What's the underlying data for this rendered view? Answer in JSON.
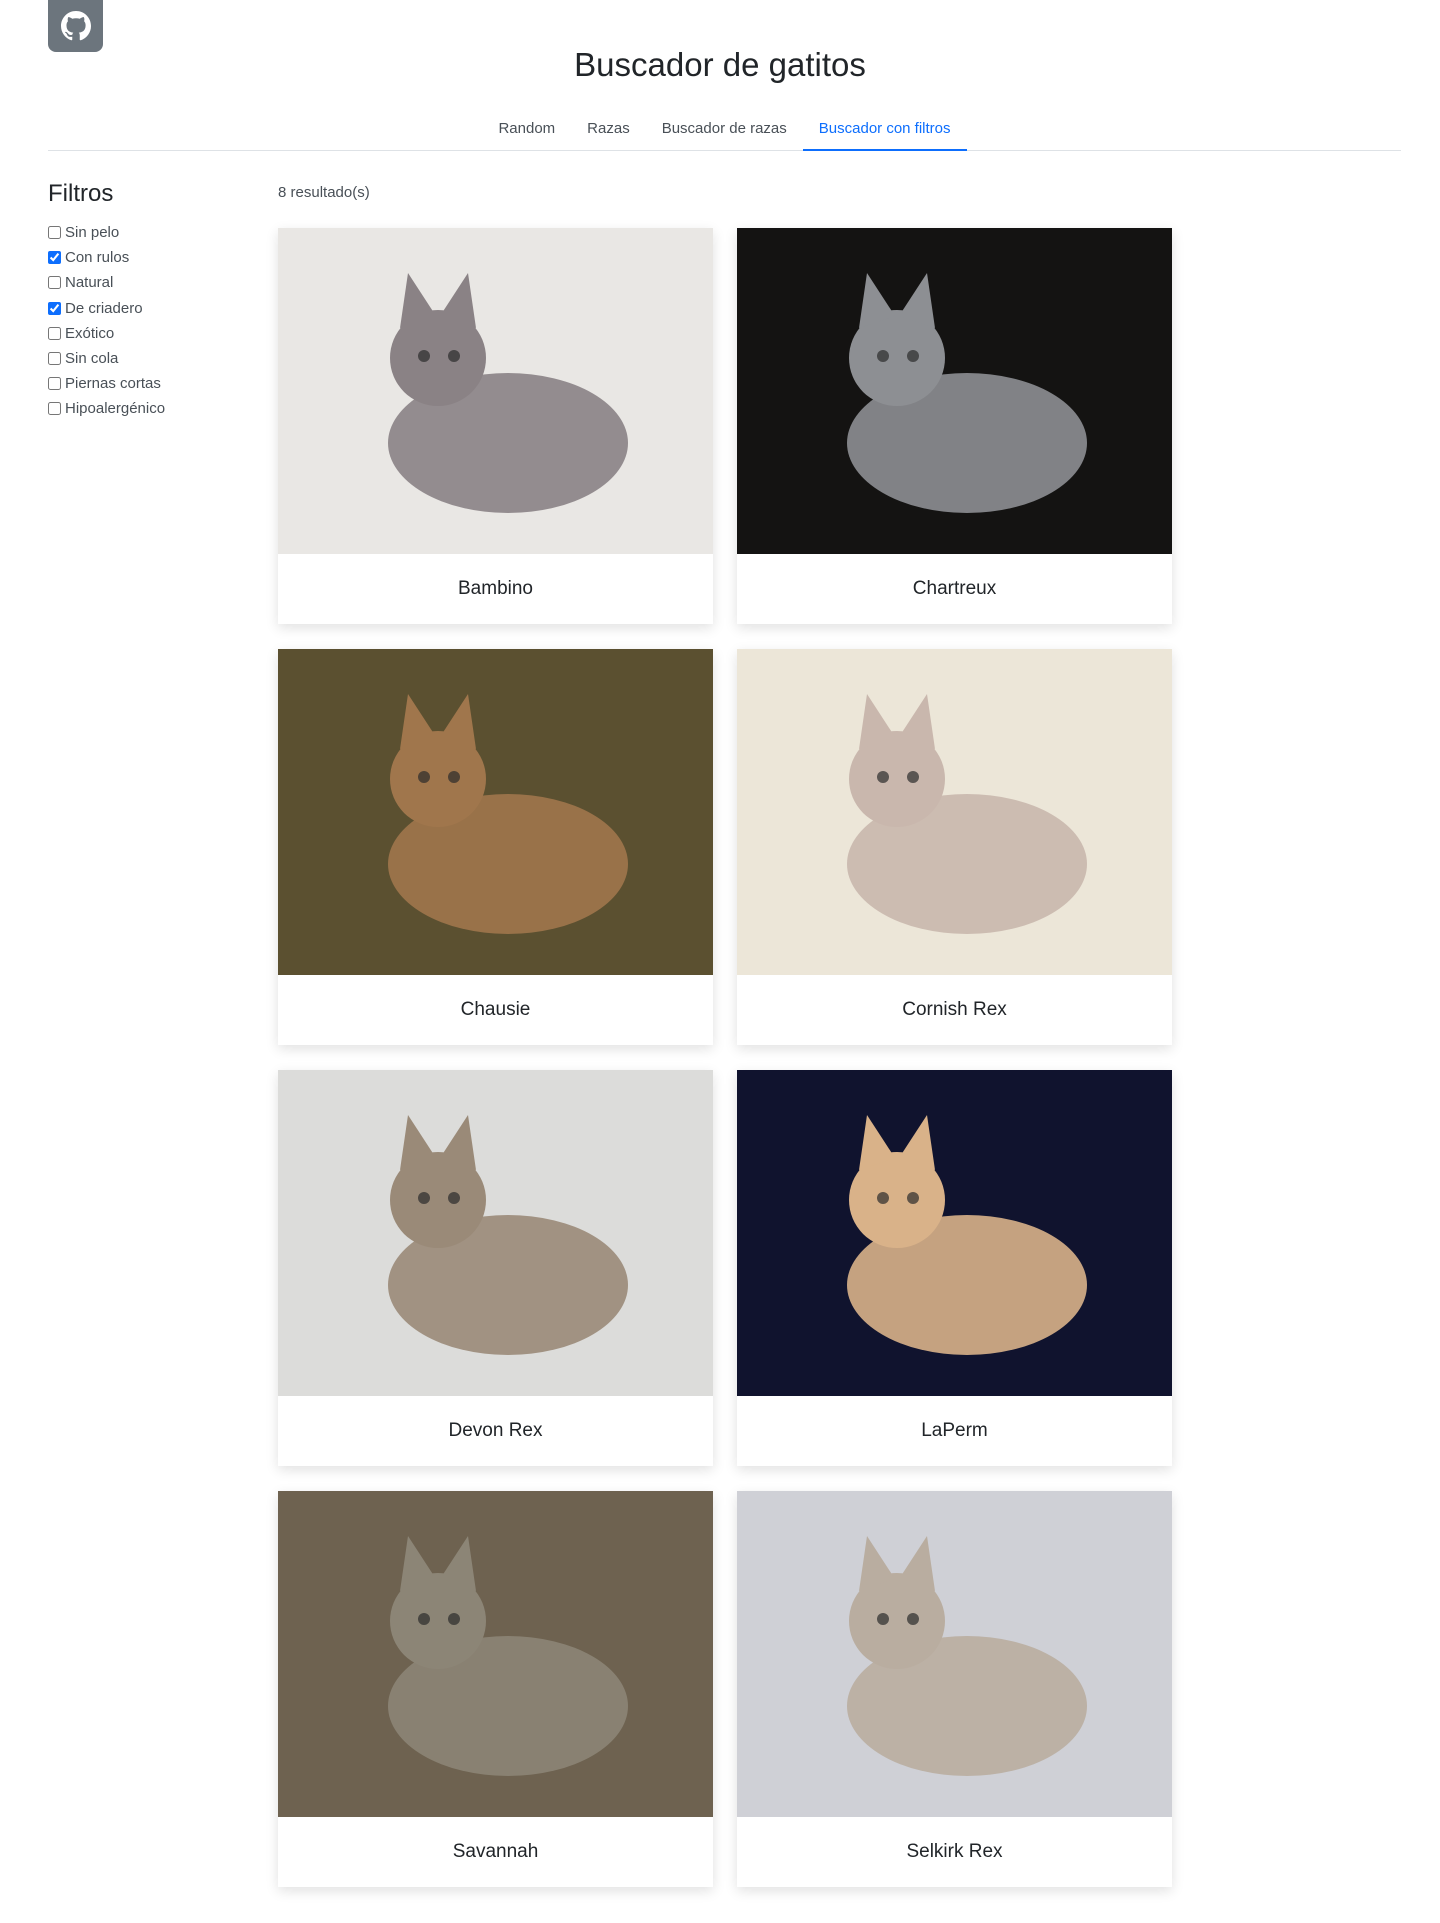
{
  "header": {
    "github_icon": "github-icon",
    "title": "Buscador de gatitos"
  },
  "nav": {
    "tabs": [
      {
        "label": "Random",
        "active": false
      },
      {
        "label": "Razas",
        "active": false
      },
      {
        "label": "Buscador de razas",
        "active": false
      },
      {
        "label": "Buscador con filtros",
        "active": true
      }
    ]
  },
  "filters": {
    "title": "Filtros",
    "items": [
      {
        "label": "Sin pelo",
        "checked": false
      },
      {
        "label": "Con rulos",
        "checked": true
      },
      {
        "label": "Natural",
        "checked": false
      },
      {
        "label": "De criadero",
        "checked": true
      },
      {
        "label": "Exótico",
        "checked": false
      },
      {
        "label": "Sin cola",
        "checked": false
      },
      {
        "label": "Piernas cortas",
        "checked": false
      },
      {
        "label": "Hipoalergénico",
        "checked": false
      }
    ]
  },
  "results": {
    "count_label": "8 resultado(s)",
    "cards": [
      {
        "name": "Bambino",
        "bg": "#e9e7e4",
        "fg": "#8a8285"
      },
      {
        "name": "Chartreux",
        "bg": "#141312",
        "fg": "#8d8f93"
      },
      {
        "name": "Chausie",
        "bg": "#5b5030",
        "fg": "#a0764c"
      },
      {
        "name": "Cornish Rex",
        "bg": "#ece6d8",
        "fg": "#c9b7ad"
      },
      {
        "name": "Devon Rex",
        "bg": "#dcdcda",
        "fg": "#9a8a78"
      },
      {
        "name": "LaPerm",
        "bg": "#10132e",
        "fg": "#d9b289"
      },
      {
        "name": "Savannah",
        "bg": "#6e6250",
        "fg": "#8c8576"
      },
      {
        "name": "Selkirk Rex",
        "bg": "#cfd0d6",
        "fg": "#b9ada0"
      }
    ]
  }
}
